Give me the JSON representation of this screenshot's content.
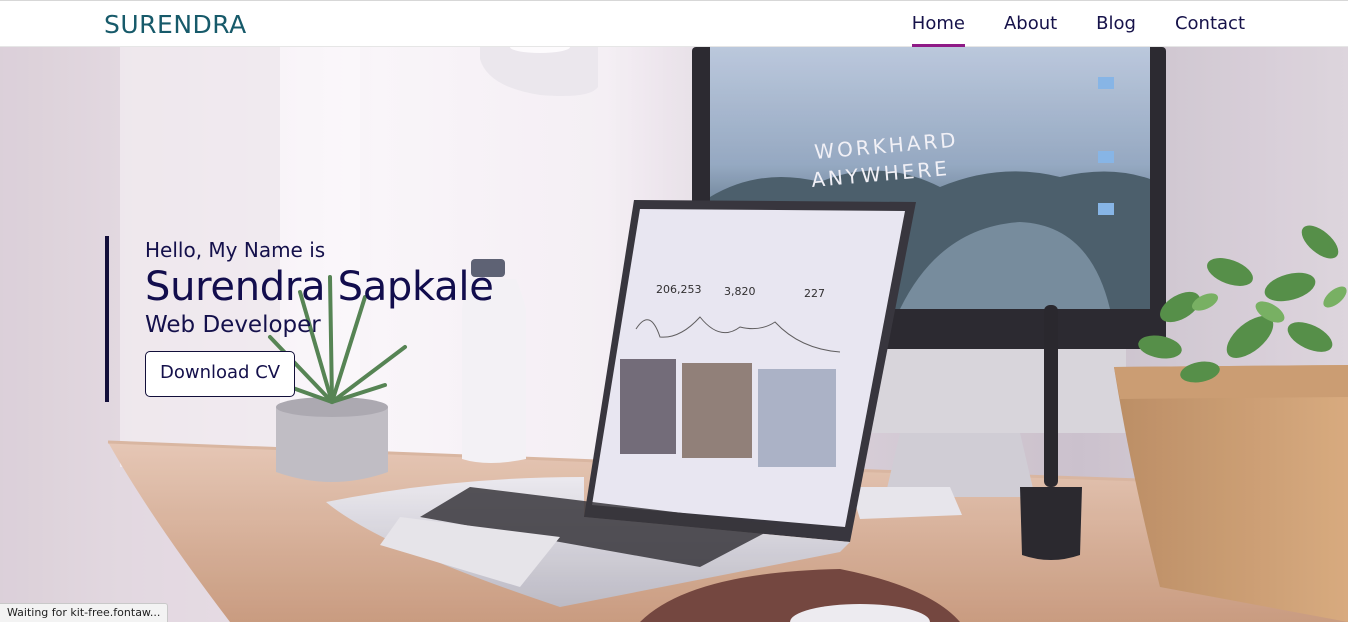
{
  "brand": "SURENDRA",
  "nav": {
    "items": [
      {
        "label": "Home",
        "active": true
      },
      {
        "label": "About",
        "active": false
      },
      {
        "label": "Blog",
        "active": false
      },
      {
        "label": "Contact",
        "active": false
      }
    ]
  },
  "hero": {
    "greeting": "Hello, My Name is",
    "name": "Surendra Sapkale",
    "role": "Web Developer",
    "cta_label": "Download CV",
    "monitor_text_line1": "WORKHARD",
    "monitor_text_line2": "ANYWHERE",
    "laptop_stats": [
      "206,253",
      "3,820",
      "227"
    ]
  },
  "status": "Waiting for kit-free.fontaw...",
  "colors": {
    "brand": "#175a6a",
    "nav_text": "#16124a",
    "nav_active_underline": "#8f1b86",
    "hero_text": "#120d4d"
  }
}
